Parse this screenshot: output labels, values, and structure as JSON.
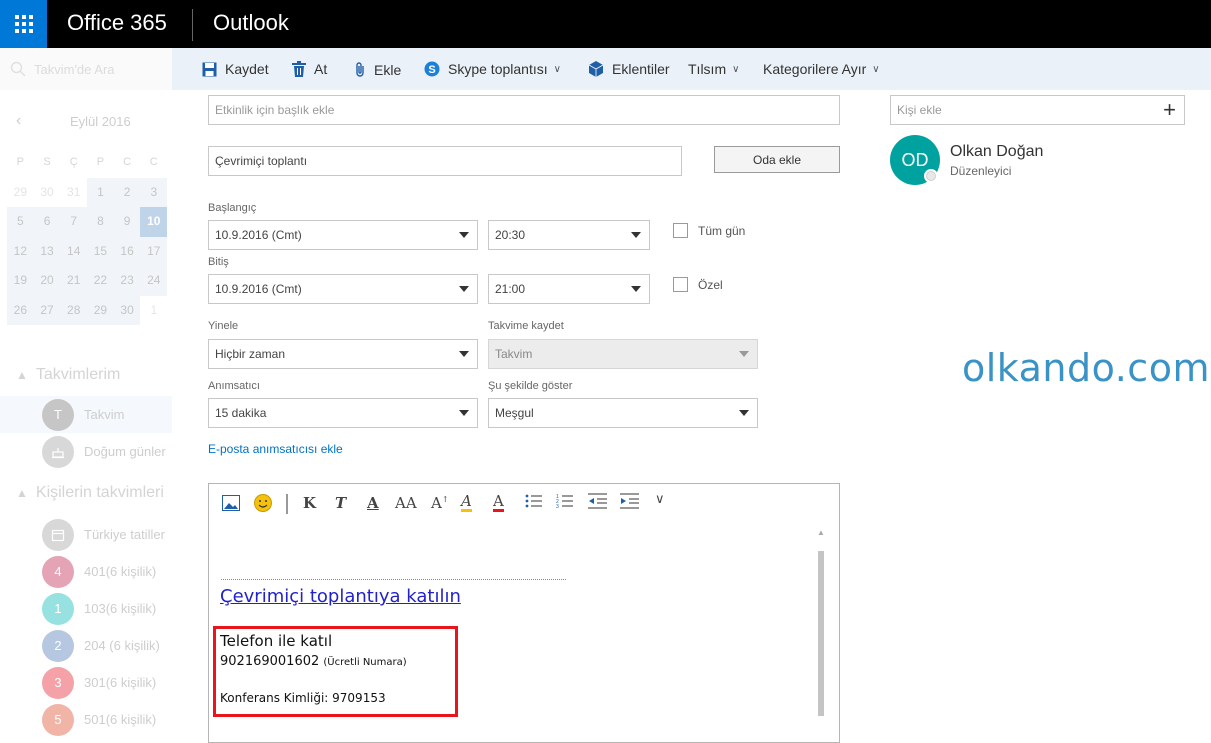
{
  "topbar": {
    "brand": "Office 365",
    "app": "Outlook"
  },
  "sidebar": {
    "search_placeholder": "Takvim'de Ara",
    "month": "Eylül 2016",
    "weekdays": [
      "P",
      "S",
      "Ç",
      "P",
      "C",
      "C"
    ],
    "weeks": [
      [
        "29",
        "30",
        "31",
        "1",
        "2",
        "3"
      ],
      [
        "5",
        "6",
        "7",
        "8",
        "9",
        "10"
      ],
      [
        "12",
        "13",
        "14",
        "15",
        "16",
        "17"
      ],
      [
        "19",
        "20",
        "21",
        "22",
        "23",
        "24"
      ],
      [
        "26",
        "27",
        "28",
        "29",
        "30",
        "1"
      ]
    ],
    "my_calendars_title": "Takvimlerim",
    "my_calendars": [
      {
        "initial": "T",
        "label": "Takvim",
        "color": "#8c8c8c"
      },
      {
        "initial": "",
        "label": "Doğum günler",
        "color": "#b0b0b0"
      }
    ],
    "people_calendars_title": "Kişilerin takvimleri",
    "people_calendars": [
      {
        "initial": "",
        "label": "Türkiye tatiller",
        "color": "#b0b0b0"
      },
      {
        "initial": "4",
        "label": "401(6 kişilik)",
        "color": "#c8486b"
      },
      {
        "initial": "1",
        "label": "103(6 kişilik)",
        "color": "#2ec5c0"
      },
      {
        "initial": "2",
        "label": "204 (6 kişilik)",
        "color": "#6d8fc2"
      },
      {
        "initial": "3",
        "label": "301(6 kişilik)",
        "color": "#e8434f"
      },
      {
        "initial": "5",
        "label": "501(6 kişilik)",
        "color": "#e36a4e"
      }
    ]
  },
  "commandbar": {
    "save": "Kaydet",
    "discard": "At",
    "attach": "Ekle",
    "skype": "Skype toplantısı",
    "addins": "Eklentiler",
    "charm": "Tılsım",
    "categorize": "Kategorilere Ayır"
  },
  "form": {
    "title_placeholder": "Etkinlik için başlık ekle",
    "location": "Çevrimiçi toplantı",
    "add_room": "Oda ekle",
    "start_label": "Başlangıç",
    "start_date": "10.9.2016 (Cmt)",
    "start_time": "20:30",
    "all_day": "Tüm gün",
    "end_label": "Bitiş",
    "end_date": "10.9.2016 (Cmt)",
    "end_time": "21:00",
    "private": "Özel",
    "repeat_label": "Yinele",
    "repeat_value": "Hiçbir zaman",
    "save_to_label": "Takvime kaydet",
    "save_to_value": "Takvim",
    "reminder_label": "Anımsatıcı",
    "reminder_value": "15 dakika",
    "show_as_label": "Şu şekilde göster",
    "show_as_value": "Meşgul",
    "email_reminder": "E-posta anımsatıcısı ekle"
  },
  "editor": {
    "join_link": "Çevrimiçi toplantıya katılın",
    "phone_title": "Telefon ile katıl",
    "phone_number": "902169001602",
    "phone_note": "(Ücretli Numara)",
    "conference_id": "Konferans Kimliği: 9709153"
  },
  "attendees": {
    "placeholder": "Kişi ekle",
    "organizer_initials": "OD",
    "organizer_name": "Olkan Doğan",
    "organizer_role": "Düzenleyici"
  },
  "watermark": "olkando.com"
}
